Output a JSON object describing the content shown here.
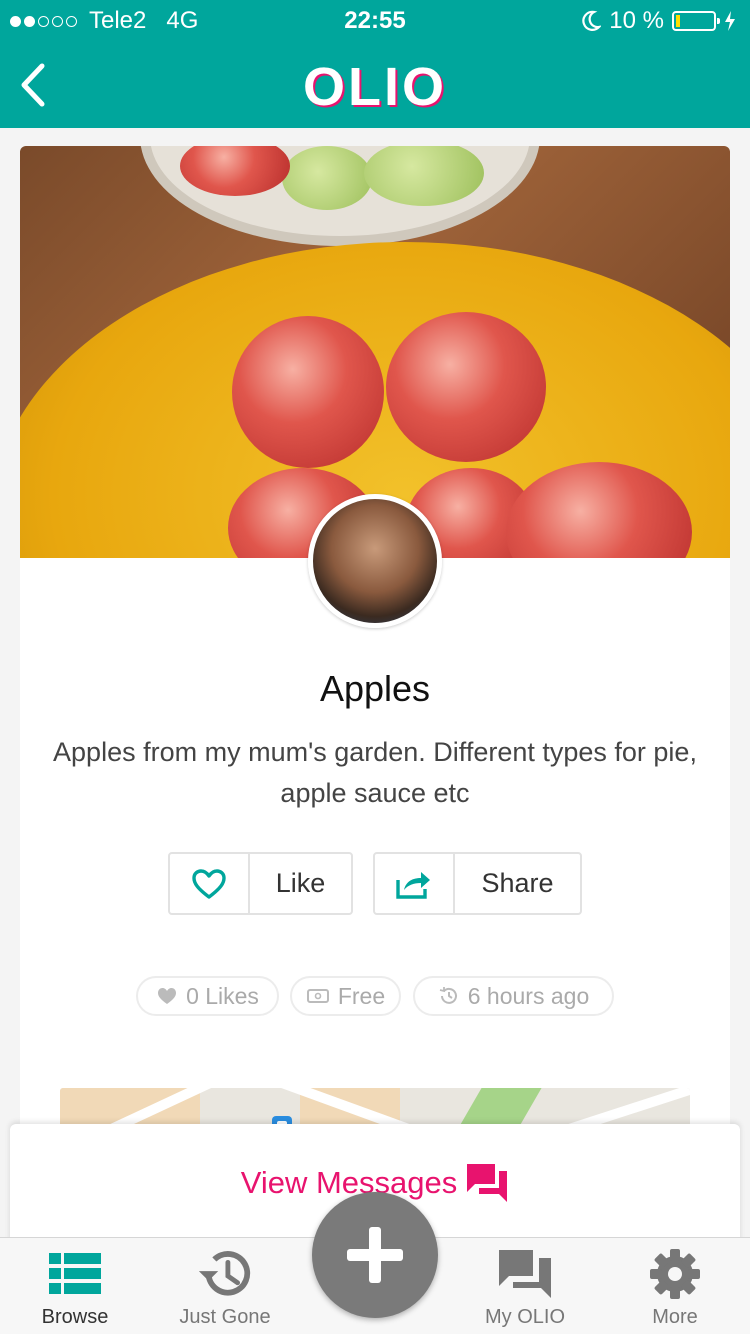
{
  "status_bar": {
    "carrier": "Tele2",
    "network": "4G",
    "time": "22:55",
    "battery_percent": "10 %",
    "battery_level": 0.1
  },
  "header": {
    "logo": "OLIO",
    "back_icon": "chevron-left-icon"
  },
  "listing": {
    "title": "Apples",
    "description": "Apples from my mum's garden. Different types for pie, apple sauce etc",
    "like_label": "Like",
    "share_label": "Share",
    "likes_count": "0 Likes",
    "price": "Free",
    "posted": "6 hours ago"
  },
  "messages": {
    "label": "View Messages"
  },
  "tabs": [
    {
      "label": "Browse",
      "icon": "list-icon",
      "active": true
    },
    {
      "label": "Just Gone",
      "icon": "history-icon"
    },
    {
      "label": "add",
      "icon": "plus-icon"
    },
    {
      "label": "My OLIO",
      "icon": "chat-icon"
    },
    {
      "label": "More",
      "icon": "gear-icon"
    }
  ],
  "colors": {
    "brand": "#00a69c",
    "accent": "#e8136e",
    "fab": "#7a7a7a"
  }
}
